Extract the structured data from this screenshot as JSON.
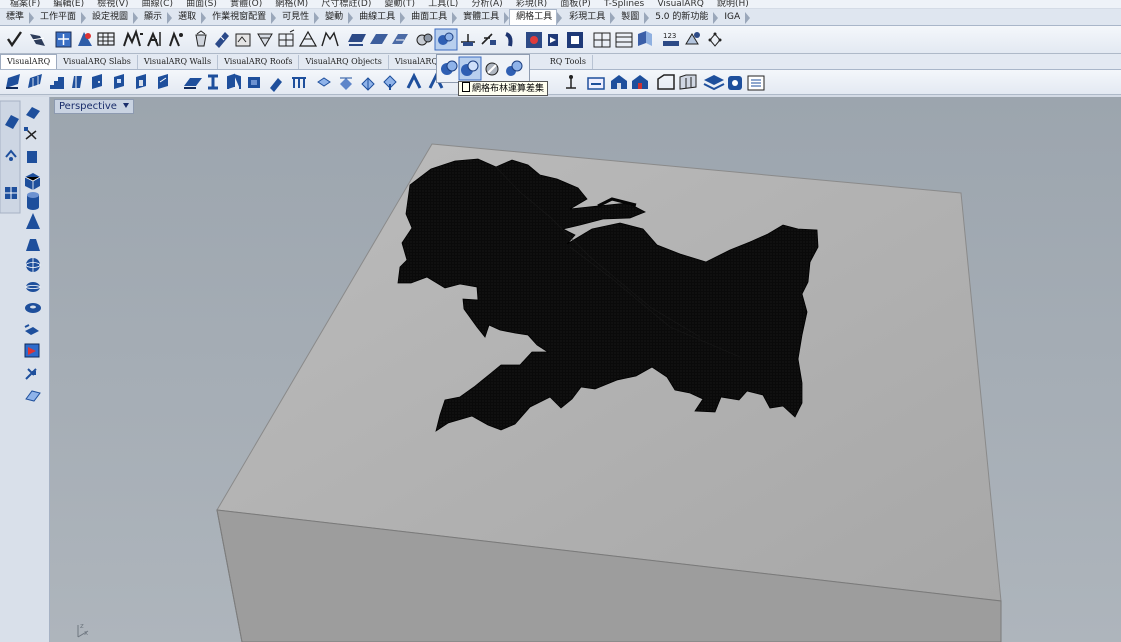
{
  "menubar": {
    "items": [
      "檔案(F)",
      "編輯(E)",
      "檢視(V)",
      "曲線(C)",
      "曲面(S)",
      "實體(O)",
      "網格(M)",
      "尺寸標註(D)",
      "變動(T)",
      "工具(L)",
      "分析(A)",
      "彩現(R)",
      "面板(P)",
      "T-Splines",
      "VisualARQ",
      "說明(H)"
    ]
  },
  "tabs": {
    "items": [
      "標準",
      "工作平面",
      "設定視圖",
      "顯示",
      "選取",
      "作業視窗配置",
      "可見性",
      "變動",
      "曲線工具",
      "曲面工具",
      "實體工具",
      "網格工具",
      "彩現工具",
      "製圖",
      "5.0 的新功能",
      "IGA"
    ],
    "active": "網格工具"
  },
  "plugin_tabs": {
    "items": [
      "VisualARQ",
      "VisualARQ Slabs",
      "VisualARQ Walls",
      "VisualARQ Roofs",
      "VisualARQ Objects",
      "VisualARQ Do",
      "RQ Tools"
    ],
    "active": "VisualARQ"
  },
  "tooltip": {
    "text": "網格布林運算差集"
  },
  "viewport": {
    "title": "Perspective",
    "axis_x": "x",
    "axis_z": "z"
  },
  "colors": {
    "accent": "#1f66c7",
    "viewport_bg": "#a3abb2",
    "box_top": "#b4b4b4",
    "box_front": "#9c9c9c",
    "mesh": "#0a0a0a"
  }
}
